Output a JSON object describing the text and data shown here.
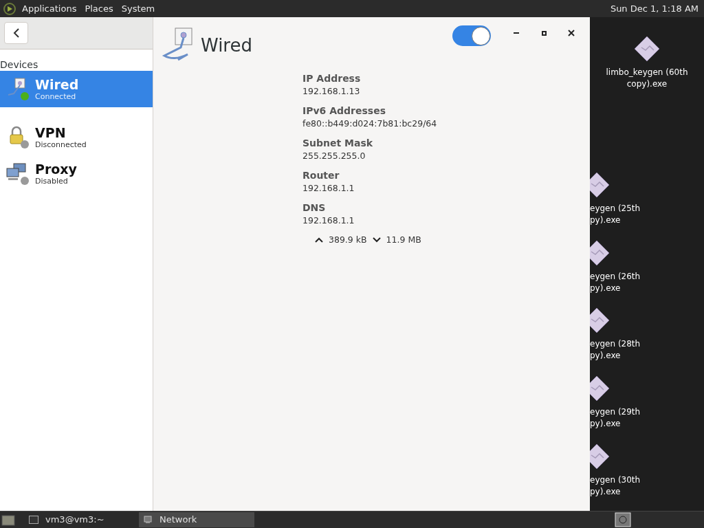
{
  "top_panel": {
    "menus": [
      "Applications",
      "Places",
      "System"
    ],
    "clock": "Sun Dec 1, 1:18 AM"
  },
  "sidebar": {
    "section": "Devices",
    "items": [
      {
        "kind": "wired",
        "name": "Wired",
        "status": "Connected",
        "selected": true,
        "color": "#4caf1c"
      },
      {
        "kind": "vpn",
        "name": "VPN",
        "status": "Disconnected",
        "selected": false,
        "color": "#9a9a9a"
      },
      {
        "kind": "proxy",
        "name": "Proxy",
        "status": "Disabled",
        "selected": false,
        "color": "#9a9a9a"
      }
    ]
  },
  "header": {
    "title": "Wired",
    "switch_on": true
  },
  "details": [
    {
      "label": "IP Address",
      "value": "192.168.1.13"
    },
    {
      "label": "IPv6 Addresses",
      "value": "fe80::b449:d024:7b81:bc29/64"
    },
    {
      "label": "Subnet Mask",
      "value": "255.255.255.0"
    },
    {
      "label": "Router",
      "value": "192.168.1.1"
    },
    {
      "label": "DNS",
      "value": "192.168.1.1"
    }
  ],
  "traffic": {
    "sent": "389.9 kB",
    "received": "11.9 MB"
  },
  "desktop_icons": [
    {
      "lines": [
        "limbo_keygen (60th",
        "copy).exe"
      ],
      "clipped": false
    },
    {
      "lines": [
        "eygen (25th",
        "py).exe"
      ],
      "clipped": true
    },
    {
      "lines": [
        "eygen (26th",
        "py).exe"
      ],
      "clipped": true
    },
    {
      "lines": [
        "eygen (28th",
        "py).exe"
      ],
      "clipped": true
    },
    {
      "lines": [
        "eygen (29th",
        "py).exe"
      ],
      "clipped": true
    },
    {
      "lines": [
        "eygen (30th",
        "py).exe"
      ],
      "clipped": true
    }
  ],
  "taskbar": {
    "tasks": [
      {
        "label": "vm3@vm3:~",
        "selected": false,
        "kind": "terminal"
      },
      {
        "label": "Network",
        "selected": true,
        "kind": "network"
      }
    ]
  }
}
